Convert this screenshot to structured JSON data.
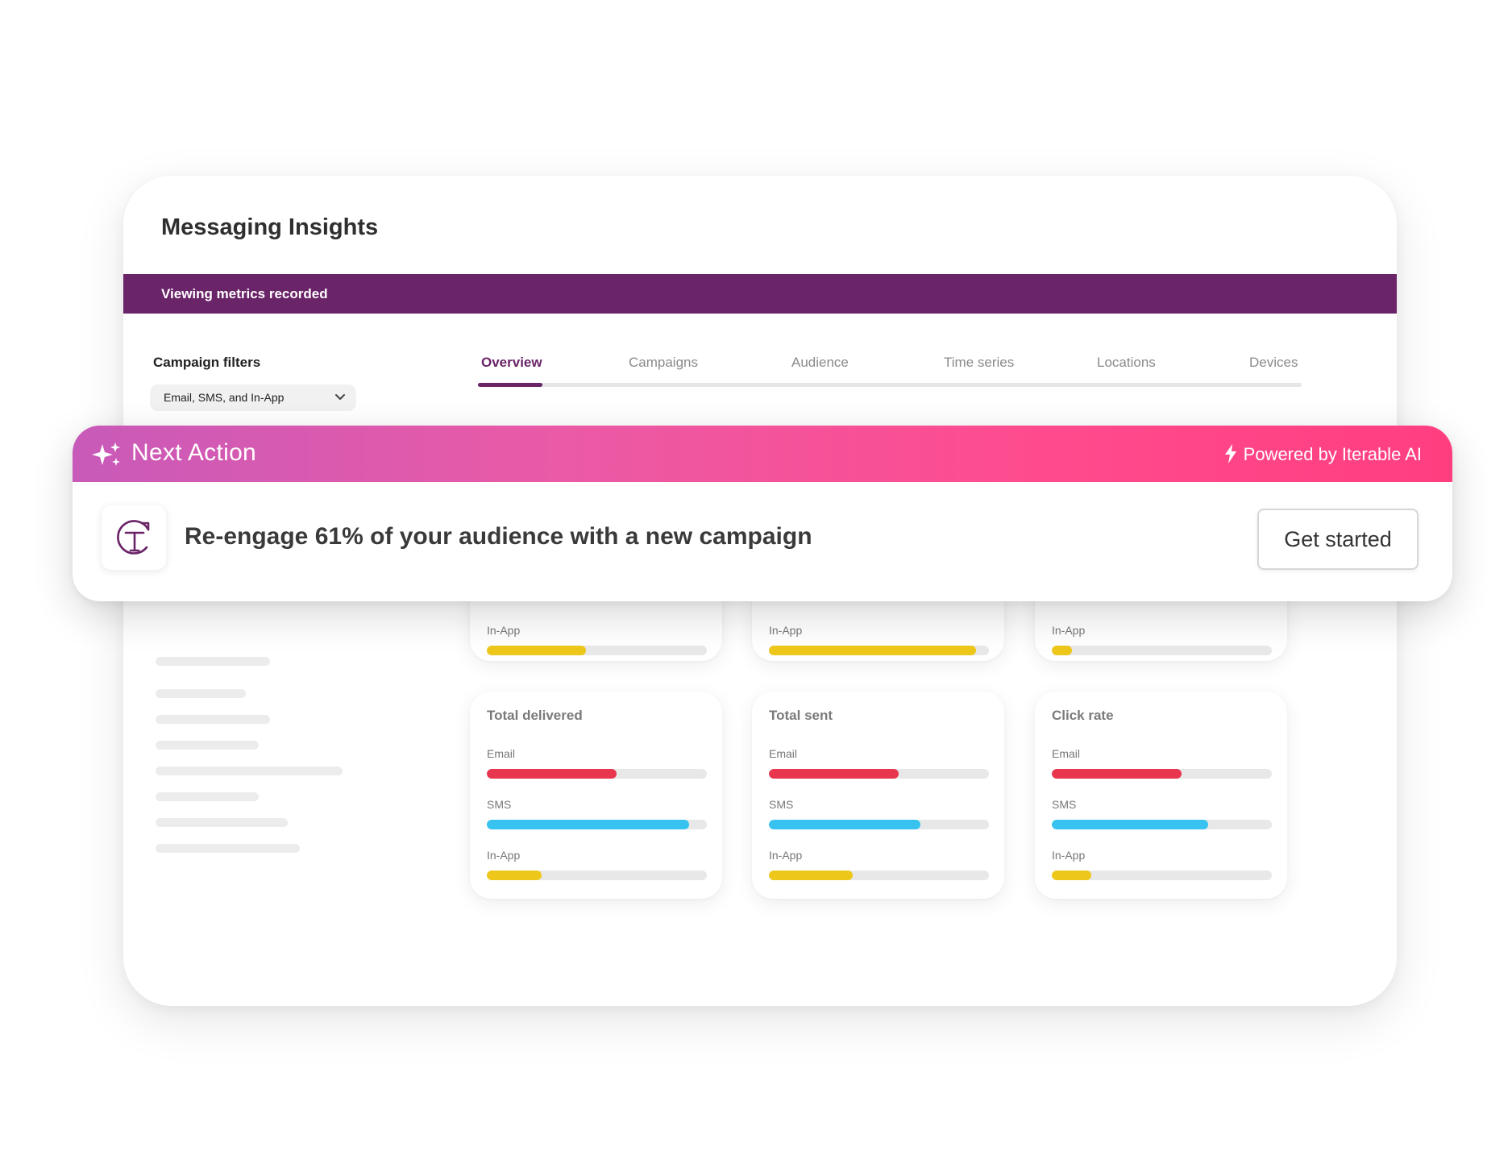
{
  "page": {
    "title": "Messaging Insights",
    "banner": "Viewing metrics recorded"
  },
  "filters": {
    "label": "Campaign filters",
    "selected": "Email, SMS, and In-App",
    "icon": "chevron-down-icon"
  },
  "tabs": [
    {
      "label": "Overview",
      "active": true
    },
    {
      "label": "Campaigns",
      "active": false
    },
    {
      "label": "Audience",
      "active": false
    },
    {
      "label": "Time series",
      "active": false
    },
    {
      "label": "Locations",
      "active": false
    },
    {
      "label": "Devices",
      "active": false
    }
  ],
  "colors": {
    "brand_purple": "#6a2468",
    "email": "#e8364f",
    "sms": "#37c2ef",
    "inapp": "#eec71b",
    "accent_pink": "#ff4b8e"
  },
  "cards_top": [
    {
      "metrics": [
        {
          "label": "In-App",
          "value": 0.45,
          "color": "#eec71b"
        }
      ]
    },
    {
      "metrics": [
        {
          "label": "In-App",
          "value": 0.94,
          "color": "#eec71b"
        }
      ]
    },
    {
      "metrics": [
        {
          "label": "In-App",
          "value": 0.09,
          "color": "#eec71b"
        }
      ]
    }
  ],
  "cards_bottom": [
    {
      "title": "Total delivered",
      "metrics": [
        {
          "label": "Email",
          "value": 0.59,
          "color": "#e8364f"
        },
        {
          "label": "SMS",
          "value": 0.92,
          "color": "#37c2ef"
        },
        {
          "label": "In-App",
          "value": 0.25,
          "color": "#eec71b"
        }
      ]
    },
    {
      "title": "Total sent",
      "metrics": [
        {
          "label": "Email",
          "value": 0.59,
          "color": "#e8364f"
        },
        {
          "label": "SMS",
          "value": 0.69,
          "color": "#37c2ef"
        },
        {
          "label": "In-App",
          "value": 0.38,
          "color": "#eec71b"
        }
      ]
    },
    {
      "title": "Click rate",
      "metrics": [
        {
          "label": "Email",
          "value": 0.59,
          "color": "#e8364f"
        },
        {
          "label": "SMS",
          "value": 0.71,
          "color": "#37c2ef"
        },
        {
          "label": "In-App",
          "value": 0.18,
          "color": "#eec71b"
        }
      ]
    }
  ],
  "next_action": {
    "title": "Next Action",
    "title_icon": "sparkle-icon",
    "powered_by": "Powered by Iterable AI",
    "powered_icon": "lightning-bolt-icon",
    "logo_icon": "re-engage-t-icon",
    "message": "Re-engage 61% of your audience with a new campaign",
    "button": "Get started"
  }
}
